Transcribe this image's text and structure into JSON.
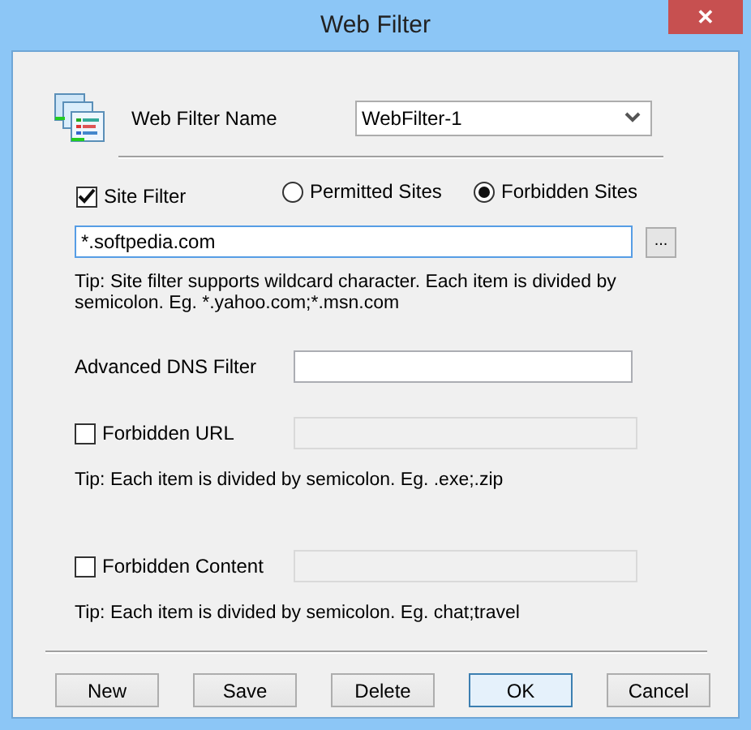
{
  "window": {
    "title": "Web Filter",
    "close_label": "✕"
  },
  "name_row": {
    "label": "Web Filter Name",
    "value": "WebFilter-1"
  },
  "site_filter": {
    "label": "Site Filter",
    "checked": true,
    "value": "*.softpedia.com",
    "browse_label": "...",
    "modes": [
      {
        "label": "Permitted Sites",
        "selected": false
      },
      {
        "label": "Forbidden Sites",
        "selected": true
      }
    ],
    "tip": "Tip: Site filter supports wildcard character. Each item is divided by semicolon. Eg. *.yahoo.com;*.msn.com"
  },
  "dns": {
    "label": "Advanced DNS Filter"
  },
  "forbidden_url": {
    "label": "Forbidden URL",
    "checked": false,
    "tip": "Tip: Each item is divided by semicolon. Eg. .exe;.zip"
  },
  "forbidden_content": {
    "label": "Forbidden Content",
    "checked": false,
    "tip": "Tip: Each item is divided by semicolon. Eg. chat;travel"
  },
  "buttons": [
    {
      "label": "New",
      "selected": false
    },
    {
      "label": "Save",
      "selected": false
    },
    {
      "label": "Delete",
      "selected": false
    },
    {
      "label": "OK",
      "selected": true
    },
    {
      "label": "Cancel",
      "selected": false
    }
  ]
}
